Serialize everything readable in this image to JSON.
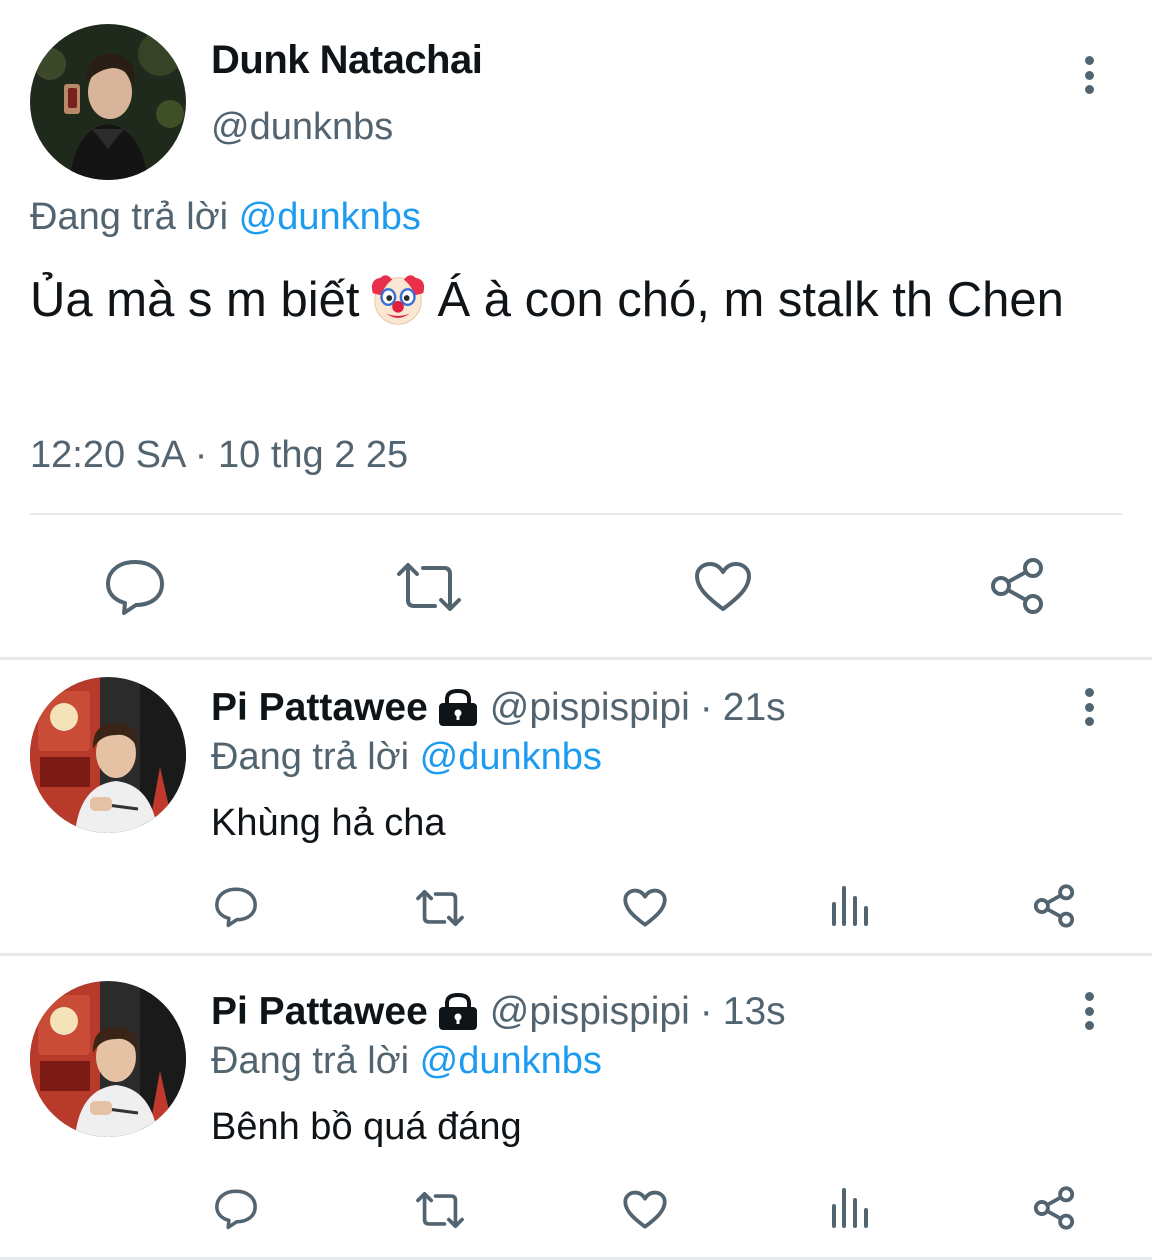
{
  "main_tweet": {
    "author_name": "Dunk Natachai",
    "author_handle": "@dunknbs",
    "reply_prefix": "Đang trả lời",
    "reply_to": "@dunknbs",
    "text_before_emoji": "Ủa mà s m biết",
    "emoji": "clown-face",
    "text_after_emoji": "Á à con chó, m stalk th Chen",
    "timestamp": "12:20 SA · 10 thg 2 25",
    "actions": [
      "reply-icon",
      "retweet-icon",
      "like-icon",
      "share-icon"
    ]
  },
  "replies": [
    {
      "author_name": "Pi Pattawee",
      "locked": true,
      "author_handle": "@pispispipi",
      "separator": "·",
      "time_ago": "21s",
      "reply_prefix": "Đang trả lời",
      "reply_to": "@dunknbs",
      "text": "Khùng hả cha",
      "actions": [
        "reply-icon",
        "retweet-icon",
        "like-icon",
        "analytics-icon",
        "share-icon"
      ]
    },
    {
      "author_name": "Pi Pattawee",
      "locked": true,
      "author_handle": "@pispispipi",
      "separator": "·",
      "time_ago": "13s",
      "reply_prefix": "Đang trả lời",
      "reply_to": "@dunknbs",
      "text": "Bênh bồ quá đáng",
      "actions": [
        "reply-icon",
        "retweet-icon",
        "like-icon",
        "analytics-icon",
        "share-icon"
      ]
    }
  ],
  "colors": {
    "text": "#0f1419",
    "secondary": "#536471",
    "link": "#1d9bf0",
    "divider": "#e6e9eb"
  }
}
